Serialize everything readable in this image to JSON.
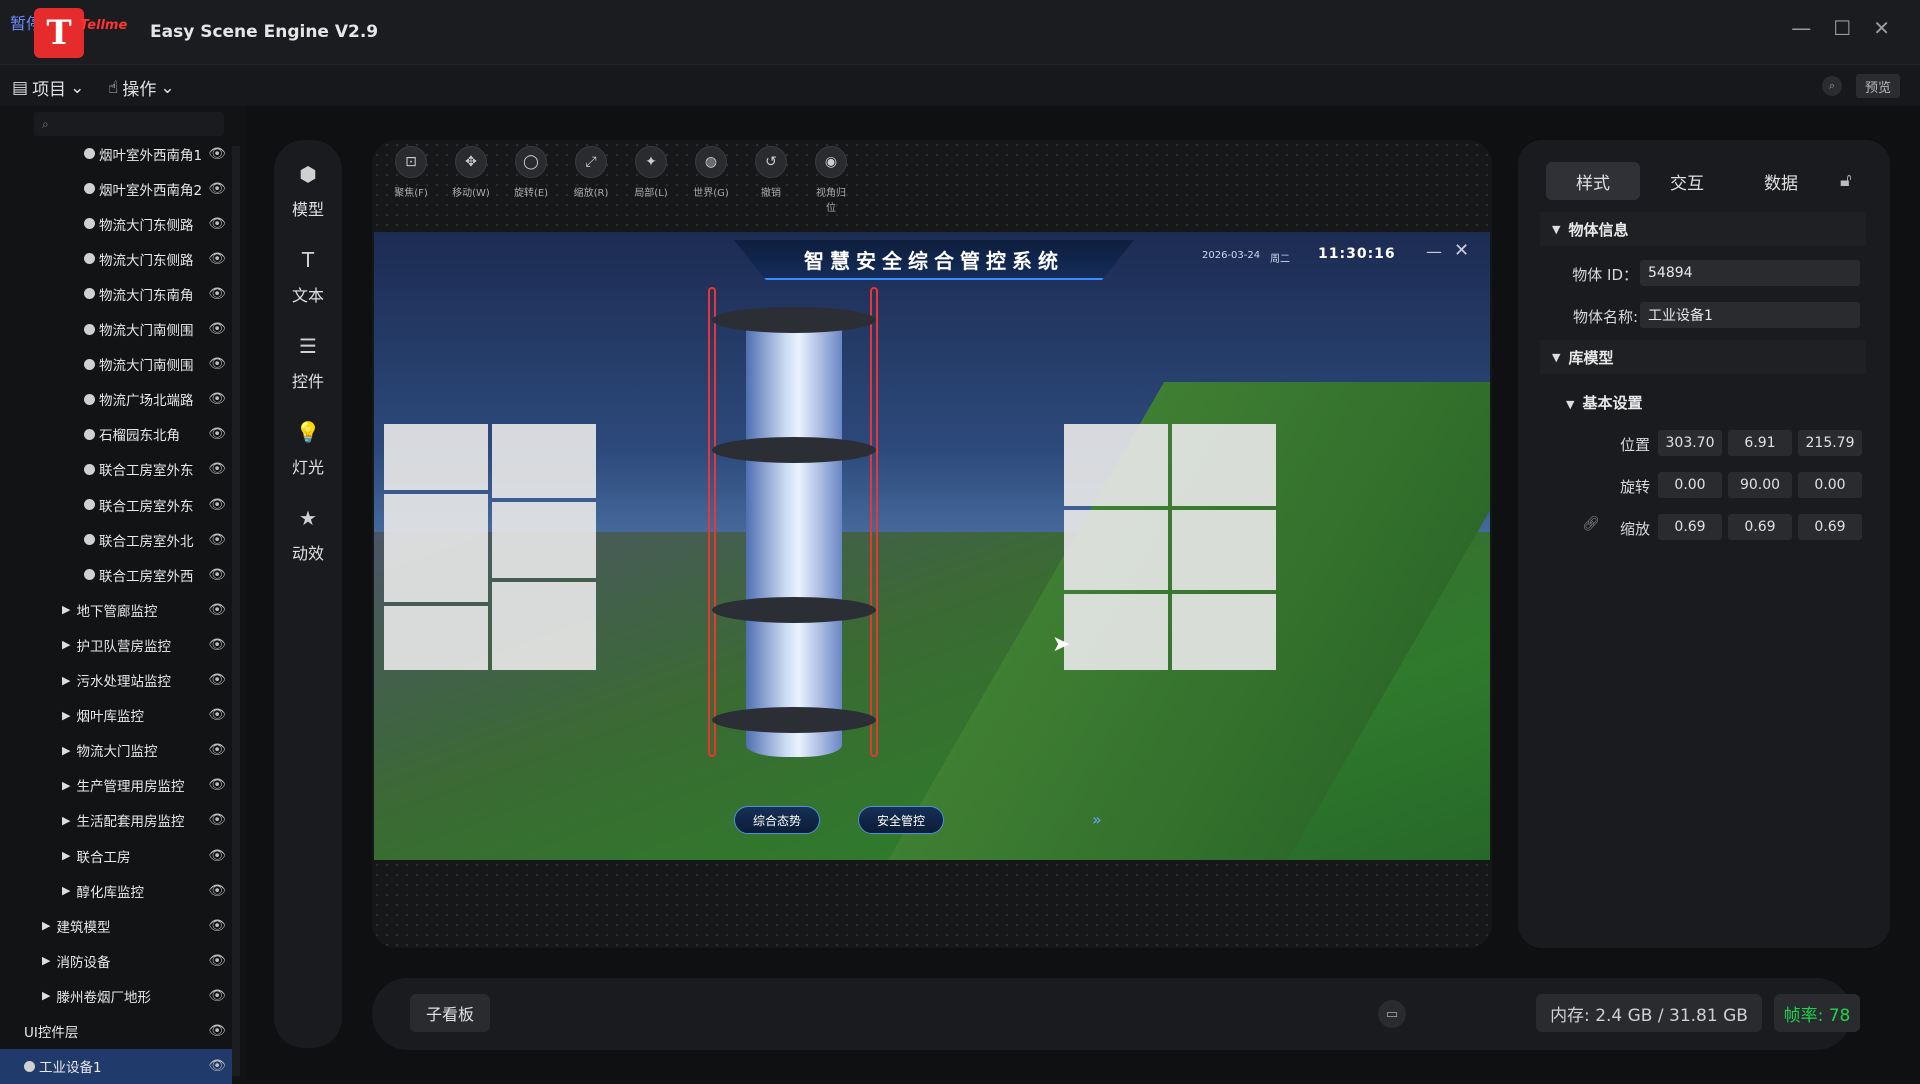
{
  "app": {
    "paused": "暂停",
    "logo_letter": "T",
    "logo_sub": "Tellme",
    "title": "Easy Scene Engine  V2.9",
    "window_controls": [
      "—",
      "☐",
      "✕"
    ]
  },
  "menubar": {
    "project": "项目",
    "operate": "操作",
    "preview": "预览"
  },
  "sidebar": {
    "items": [
      {
        "label": "烟叶室外西南角1",
        "kind": "dot",
        "indent": 84
      },
      {
        "label": "烟叶室外西南角2",
        "kind": "dot",
        "indent": 84
      },
      {
        "label": "物流大门东侧路",
        "kind": "dot",
        "indent": 84
      },
      {
        "label": "物流大门东侧路",
        "kind": "dot",
        "indent": 84
      },
      {
        "label": "物流大门东南角",
        "kind": "dot",
        "indent": 84
      },
      {
        "label": "物流大门南侧围",
        "kind": "dot",
        "indent": 84
      },
      {
        "label": "物流大门南侧围",
        "kind": "dot",
        "indent": 84
      },
      {
        "label": "物流广场北端路",
        "kind": "dot",
        "indent": 84
      },
      {
        "label": "石榴园东北角",
        "kind": "dot",
        "indent": 84
      },
      {
        "label": "联合工房室外东",
        "kind": "dot",
        "indent": 84
      },
      {
        "label": "联合工房室外东",
        "kind": "dot",
        "indent": 84
      },
      {
        "label": "联合工房室外北",
        "kind": "dot",
        "indent": 84
      },
      {
        "label": "联合工房室外西",
        "kind": "dot",
        "indent": 84
      },
      {
        "label": "地下管廊监控",
        "kind": "arrow",
        "indent": 62
      },
      {
        "label": "护卫队营房监控",
        "kind": "arrow",
        "indent": 62
      },
      {
        "label": "污水处理站监控",
        "kind": "arrow",
        "indent": 62
      },
      {
        "label": "烟叶库监控",
        "kind": "arrow",
        "indent": 62
      },
      {
        "label": "物流大门监控",
        "kind": "arrow",
        "indent": 62
      },
      {
        "label": "生产管理用房监控",
        "kind": "arrow",
        "indent": 62
      },
      {
        "label": "生活配套用房监控",
        "kind": "arrow",
        "indent": 62
      },
      {
        "label": "联合工房",
        "kind": "arrow",
        "indent": 62
      },
      {
        "label": "醇化库监控",
        "kind": "arrow",
        "indent": 62
      },
      {
        "label": "建筑模型",
        "kind": "arrow",
        "indent": 42
      },
      {
        "label": "消防设备",
        "kind": "arrow",
        "indent": 42
      },
      {
        "label": "滕州卷烟厂地形",
        "kind": "arrow",
        "indent": 42
      },
      {
        "label": "UI控件层",
        "kind": "none",
        "indent": 24
      },
      {
        "label": "工业设备1",
        "kind": "dot",
        "indent": 24,
        "selected": true
      }
    ]
  },
  "toolstrip": {
    "model": "模型",
    "text": "文本",
    "widget": "控件",
    "light": "灯光",
    "effect": "动效"
  },
  "toptools": [
    {
      "label": "聚焦(F)",
      "icon": "⊡"
    },
    {
      "label": "移动(W)",
      "icon": "✥"
    },
    {
      "label": "旋转(E)",
      "icon": "◯"
    },
    {
      "label": "缩放(R)",
      "icon": "⤢"
    },
    {
      "label": "局部(L)",
      "icon": "✦"
    },
    {
      "label": "世界(G)",
      "icon": "◍"
    },
    {
      "label": "撤销",
      "icon": "↺"
    },
    {
      "label": "视角归位",
      "icon": "◉"
    }
  ],
  "viewport": {
    "title": "智慧安全综合管控系统",
    "date": "2026-03-24",
    "weekday": "周二",
    "time": "11:30:16",
    "tab1": "综合态势",
    "tab2": "安全管控"
  },
  "bottom": {
    "subpanel": "子看板",
    "memory": "内存: 2.4 GB / 31.81 GB",
    "fps": "帧率: 78"
  },
  "rpanel": {
    "tabs": [
      "样式",
      "交互",
      "数据"
    ],
    "section_info": "物体信息",
    "id_label": "物体 ID：",
    "id_value": "54894",
    "name_label": "物体名称:",
    "name_value": "工业设备1",
    "section_model": "库模型",
    "section_basic": "基本设置",
    "pos_label": "位置",
    "pos": [
      "303.70",
      "6.91",
      "215.79"
    ],
    "rot_label": "旋转",
    "rot": [
      "0.00",
      "90.00",
      "0.00"
    ],
    "scale_label": "缩放",
    "scale": [
      "0.69",
      "0.69",
      "0.69"
    ]
  }
}
